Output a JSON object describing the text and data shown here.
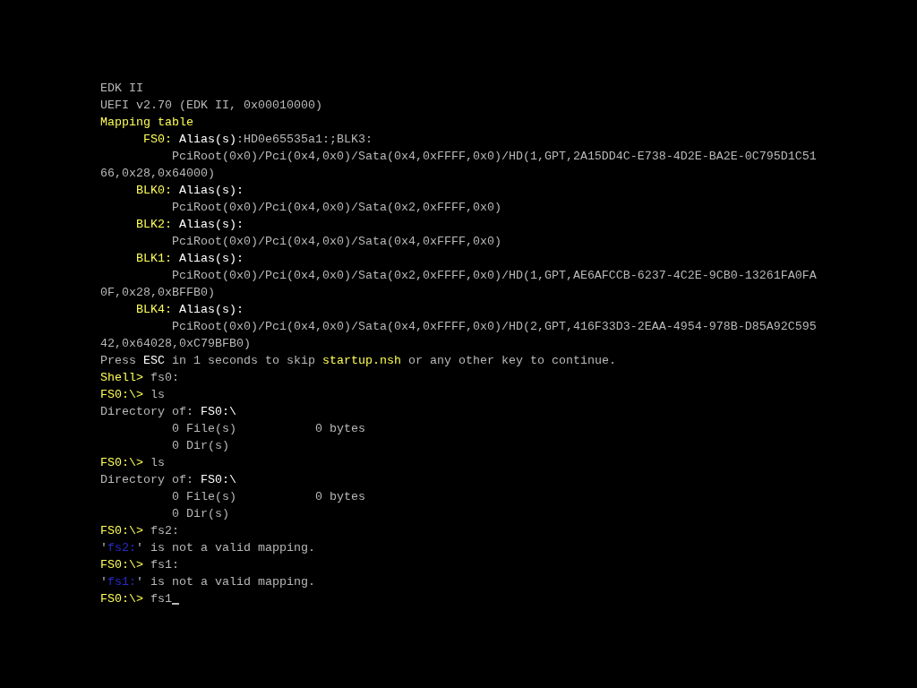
{
  "console": {
    "lines": [
      {
        "segments": [
          {
            "text": "EDK II",
            "kind": "plain"
          }
        ]
      },
      {
        "segments": [
          {
            "text": "UEFI v2.70 (EDK II, 0x00010000)",
            "kind": "plain"
          }
        ]
      },
      {
        "segments": [
          {
            "text": "Mapping table",
            "kind": "highlight"
          }
        ]
      },
      {
        "segments": [
          {
            "text": "      FS0:",
            "kind": "highlight"
          },
          {
            "text": " Alias(s)",
            "kind": "bright"
          },
          {
            "text": ":HD0e65535a1:;BLK3:",
            "kind": "plain"
          }
        ]
      },
      {
        "segments": [
          {
            "text": "          PciRoot(0x0)/Pci(0x4,0x0)/Sata(0x4,0xFFFF,0x0)/HD(1,GPT,2A15DD4C-E738-4D2E-BA2E-0C795D1C51",
            "kind": "plain"
          }
        ]
      },
      {
        "segments": [
          {
            "text": "66,0x28,0x64000)",
            "kind": "plain"
          }
        ]
      },
      {
        "segments": [
          {
            "text": "     BLK0:",
            "kind": "highlight"
          },
          {
            "text": " Alias(s):",
            "kind": "bright"
          }
        ]
      },
      {
        "segments": [
          {
            "text": "          PciRoot(0x0)/Pci(0x4,0x0)/Sata(0x2,0xFFFF,0x0)",
            "kind": "plain"
          }
        ]
      },
      {
        "segments": [
          {
            "text": "     BLK2:",
            "kind": "highlight"
          },
          {
            "text": " Alias(s):",
            "kind": "bright"
          }
        ]
      },
      {
        "segments": [
          {
            "text": "          PciRoot(0x0)/Pci(0x4,0x0)/Sata(0x4,0xFFFF,0x0)",
            "kind": "plain"
          }
        ]
      },
      {
        "segments": [
          {
            "text": "     BLK1:",
            "kind": "highlight"
          },
          {
            "text": " Alias(s):",
            "kind": "bright"
          }
        ]
      },
      {
        "segments": [
          {
            "text": "          PciRoot(0x0)/Pci(0x4,0x0)/Sata(0x2,0xFFFF,0x0)/HD(1,GPT,AE6AFCCB-6237-4C2E-9CB0-13261FA0FA",
            "kind": "plain"
          }
        ]
      },
      {
        "segments": [
          {
            "text": "0F,0x28,0xBFFB0)",
            "kind": "plain"
          }
        ]
      },
      {
        "segments": [
          {
            "text": "     BLK4:",
            "kind": "highlight"
          },
          {
            "text": " Alias(s):",
            "kind": "bright"
          }
        ]
      },
      {
        "segments": [
          {
            "text": "          PciRoot(0x0)/Pci(0x4,0x0)/Sata(0x4,0xFFFF,0x0)/HD(2,GPT,416F33D3-2EAA-4954-978B-D85A92C595",
            "kind": "plain"
          }
        ]
      },
      {
        "segments": [
          {
            "text": "42,0x64028,0xC79BFB0)",
            "kind": "plain"
          }
        ]
      },
      {
        "segments": [
          {
            "text": "Press ",
            "kind": "plain"
          },
          {
            "text": "ESC",
            "kind": "bright"
          },
          {
            "text": " in 1 seconds to skip ",
            "kind": "plain"
          },
          {
            "text": "startup.nsh",
            "kind": "highlight"
          },
          {
            "text": " or any other key to continue.",
            "kind": "plain"
          }
        ]
      },
      {
        "segments": [
          {
            "text": "Shell>",
            "kind": "highlight"
          },
          {
            "text": " fs0:",
            "kind": "plain"
          }
        ]
      },
      {
        "segments": [
          {
            "text": "FS0:\\>",
            "kind": "highlight"
          },
          {
            "text": " ls",
            "kind": "plain"
          }
        ]
      },
      {
        "segments": [
          {
            "text": "Directory of: ",
            "kind": "plain"
          },
          {
            "text": "FS0:\\",
            "kind": "bright"
          }
        ]
      },
      {
        "segments": [
          {
            "text": "          0 File(s)           0 bytes",
            "kind": "plain"
          }
        ]
      },
      {
        "segments": [
          {
            "text": "          0 Dir(s)",
            "kind": "plain"
          }
        ]
      },
      {
        "segments": [
          {
            "text": "FS0:\\>",
            "kind": "highlight"
          },
          {
            "text": " ls",
            "kind": "plain"
          }
        ]
      },
      {
        "segments": [
          {
            "text": "Directory of: ",
            "kind": "plain"
          },
          {
            "text": "FS0:\\",
            "kind": "bright"
          }
        ]
      },
      {
        "segments": [
          {
            "text": "          0 File(s)           0 bytes",
            "kind": "plain"
          }
        ]
      },
      {
        "segments": [
          {
            "text": "          0 Dir(s)",
            "kind": "plain"
          }
        ]
      },
      {
        "segments": [
          {
            "text": "FS0:\\>",
            "kind": "highlight"
          },
          {
            "text": " fs2:",
            "kind": "plain"
          }
        ]
      },
      {
        "segments": [
          {
            "text": "'",
            "kind": "plain"
          },
          {
            "text": "fs2:",
            "kind": "invalid"
          },
          {
            "text": "' is not a valid mapping.",
            "kind": "plain"
          }
        ]
      },
      {
        "segments": [
          {
            "text": "FS0:\\>",
            "kind": "highlight"
          },
          {
            "text": " fs1:",
            "kind": "plain"
          }
        ]
      },
      {
        "segments": [
          {
            "text": "'",
            "kind": "plain"
          },
          {
            "text": "fs1:",
            "kind": "invalid"
          },
          {
            "text": "' is not a valid mapping.",
            "kind": "plain"
          }
        ]
      },
      {
        "segments": [
          {
            "text": "FS0:\\>",
            "kind": "highlight"
          },
          {
            "text": " fs1",
            "kind": "plain"
          }
        ],
        "cursor": true
      }
    ]
  }
}
